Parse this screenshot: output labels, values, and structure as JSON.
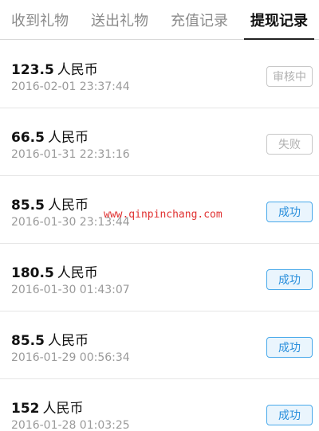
{
  "tabs": [
    {
      "label": "收到礼物"
    },
    {
      "label": "送出礼物"
    },
    {
      "label": "充值记录"
    },
    {
      "label": "提现记录"
    }
  ],
  "records": [
    {
      "amount": "123.5",
      "unit": "人民币",
      "time": "2016-02-01 23:37:44",
      "status": "审核中"
    },
    {
      "amount": "66.5",
      "unit": "人民币",
      "time": "2016-01-31 22:31:16",
      "status": "失败"
    },
    {
      "amount": "85.5",
      "unit": "人民币",
      "time": "2016-01-30 23:13:44",
      "status": "成功"
    },
    {
      "amount": "180.5",
      "unit": "人民币",
      "time": "2016-01-30 01:43:07",
      "status": "成功"
    },
    {
      "amount": "85.5",
      "unit": "人民币",
      "time": "2016-01-29 00:56:34",
      "status": "成功"
    },
    {
      "amount": "152",
      "unit": "人民币",
      "time": "2016-01-28 01:03:25",
      "status": "成功"
    }
  ],
  "watermark": "www.qinpinchang.com",
  "colors": {
    "success": "#2a8fdc",
    "neutral": "#b0b0b0"
  }
}
